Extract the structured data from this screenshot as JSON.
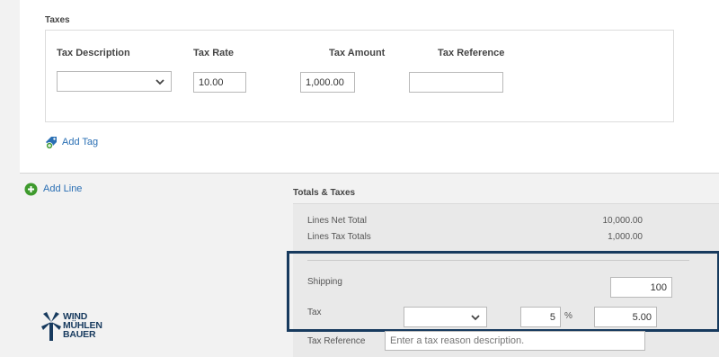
{
  "taxes": {
    "section_title": "Taxes",
    "headers": [
      "Tax Description",
      "Tax Rate",
      "Tax Amount",
      "Tax Reference"
    ],
    "row": {
      "tax_description": "",
      "tax_rate": "10.00",
      "tax_amount": "1,000.00",
      "tax_reference": ""
    },
    "add_tag_label": "Add Tag"
  },
  "add_line_label": "Add Line",
  "totals": {
    "title": "Totals & Taxes",
    "lines_net_total_label": "Lines Net Total",
    "lines_net_total_value": "10,000.00",
    "lines_tax_totals_label": "Lines Tax Totals",
    "lines_tax_totals_value": "1,000.00",
    "shipping_label": "Shipping",
    "shipping_value": "100",
    "tax_label": "Tax",
    "tax_select_value": "",
    "tax_percent_value": "5",
    "percent_symbol": "%",
    "tax_amount_value": "5.00",
    "tax_reference_label": "Tax Reference",
    "tax_reference_placeholder": "Enter a tax reason description."
  },
  "logo": {
    "lines": [
      "WIND",
      "MÜHLEN",
      "BAUER"
    ]
  },
  "colors": {
    "accent_blue": "#2a6fb4",
    "highlight_border": "#173a5e",
    "add_green": "#3e9a2d"
  }
}
